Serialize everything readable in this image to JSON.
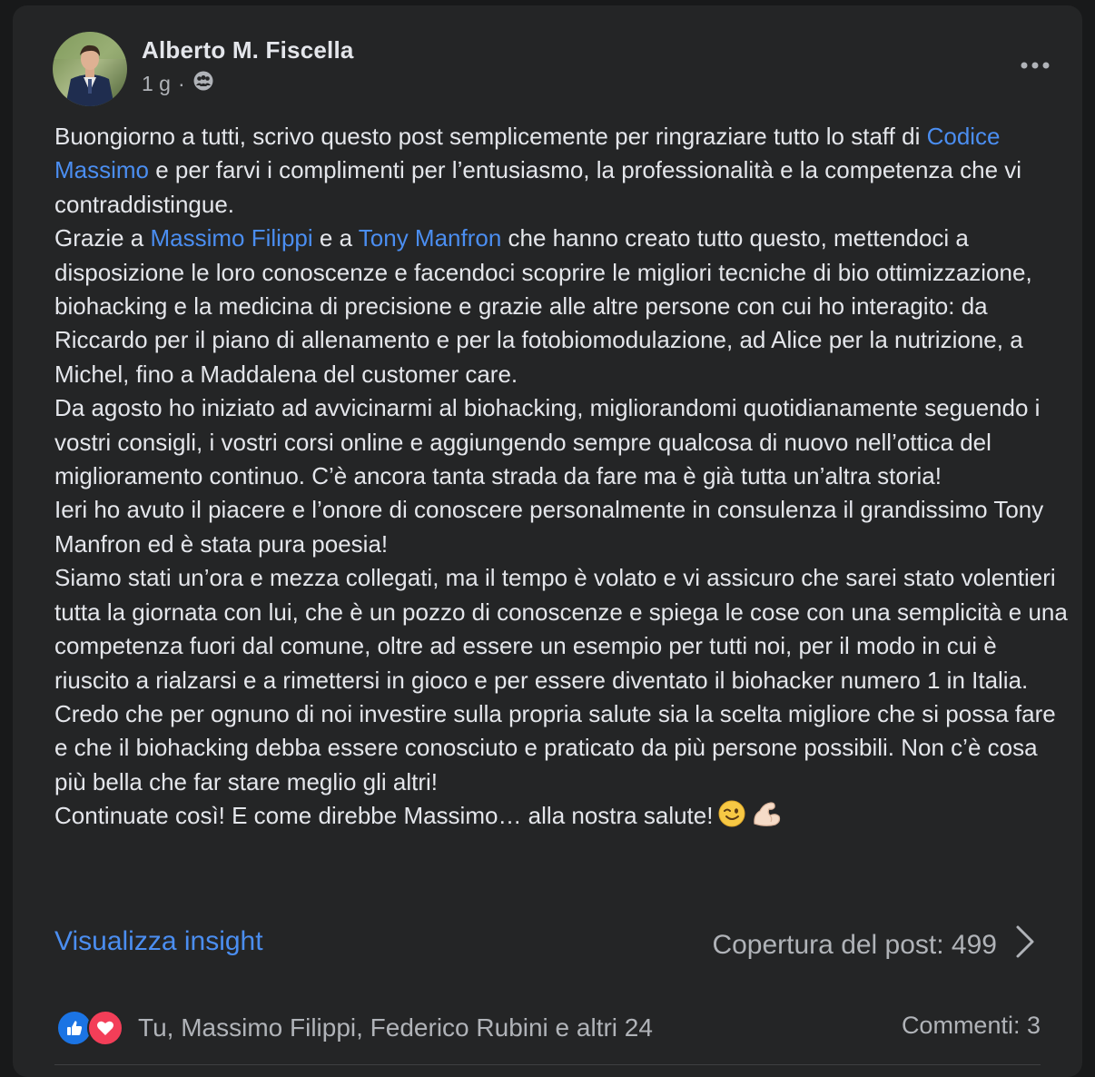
{
  "post": {
    "author": "Alberto M. Fiscella",
    "time": "1 g",
    "separator": "·",
    "audience_icon": "friends-icon",
    "menu_icon": "more-dots-icon",
    "paragraphs": [
      {
        "segments": [
          {
            "text": "Buongiorno a tutti, scrivo questo post semplicemente per ringraziare tutto lo staff di ",
            "link": false
          },
          {
            "text": "Codice Massimo",
            "link": true
          },
          {
            "text": " e per farvi i complimenti per l’entusiasmo, la professionalità e la competenza che vi contraddistingue.",
            "link": false
          }
        ]
      },
      {
        "segments": [
          {
            "text": "Grazie a ",
            "link": false
          },
          {
            "text": "Massimo Filippi",
            "link": true
          },
          {
            "text": " e a ",
            "link": false
          },
          {
            "text": "Tony Manfron",
            "link": true
          },
          {
            "text": " che hanno creato tutto questo, mettendoci a disposizione le loro conoscenze e facendoci scoprire le migliori tecniche di bio ottimizzazione, biohacking e la medicina di precisione e grazie alle altre persone con cui ho interagito: da Riccardo per il piano di allenamento e per la fotobiomodulazione, ad Alice per la nutrizione, a Michel, fino a Maddalena del customer care.",
            "link": false
          }
        ]
      },
      {
        "segments": [
          {
            "text": "Da agosto ho iniziato ad avvicinarmi al biohacking, migliorandomi quotidianamente seguendo i vostri consigli, i vostri corsi online e aggiungendo sempre qualcosa di nuovo nell’ottica del miglioramento continuo. C’è ancora tanta strada da fare ma è già tutta un’altra storia!",
            "link": false
          }
        ]
      },
      {
        "segments": [
          {
            "text": "Ieri ho avuto il piacere e l’onore di conoscere personalmente in consulenza il grandissimo Tony Manfron ed è stata pura poesia!",
            "link": false
          }
        ]
      },
      {
        "segments": [
          {
            "text": "Siamo stati un’ora e mezza collegati, ma il tempo è volato e vi assicuro che sarei stato volentieri tutta la giornata con lui, che è un pozzo di conoscenze e spiega le cose con una semplicità e una competenza fuori dal comune, oltre ad essere un esempio per tutti noi, per il modo in cui è riuscito a rialzarsi e a rimettersi in gioco e per essere diventato il biohacker numero 1 in Italia.",
            "link": false
          }
        ]
      },
      {
        "segments": [
          {
            "text": "Credo che per ognuno di noi investire sulla propria salute sia la scelta migliore che si possa fare e che il biohacking debba essere conosciuto e praticato da più persone possibili. Non c’è cosa più bella che far stare meglio gli altri!",
            "link": false
          }
        ]
      },
      {
        "segments": [
          {
            "text": "Continuate così! E come direbbe Massimo… alla nostra salute!",
            "link": false
          }
        ],
        "emojis": [
          "wink-emoji",
          "flexed-biceps-emoji"
        ]
      }
    ],
    "insight_label": "Visualizza insight",
    "reach_label": "Copertura del post: 499",
    "reactions": {
      "icons": [
        "like-icon",
        "love-icon"
      ],
      "names": "Tu, Massimo Filippi, Federico Rubini e altri 24"
    },
    "comments_label": "Commenti: 3"
  },
  "colors": {
    "background": "#18191a",
    "card": "#242526",
    "text": "#e4e6eb",
    "secondary_text": "#b0b3b8",
    "link": "#4b8ef1",
    "like": "#1b74e4",
    "love": "#f33e58"
  }
}
